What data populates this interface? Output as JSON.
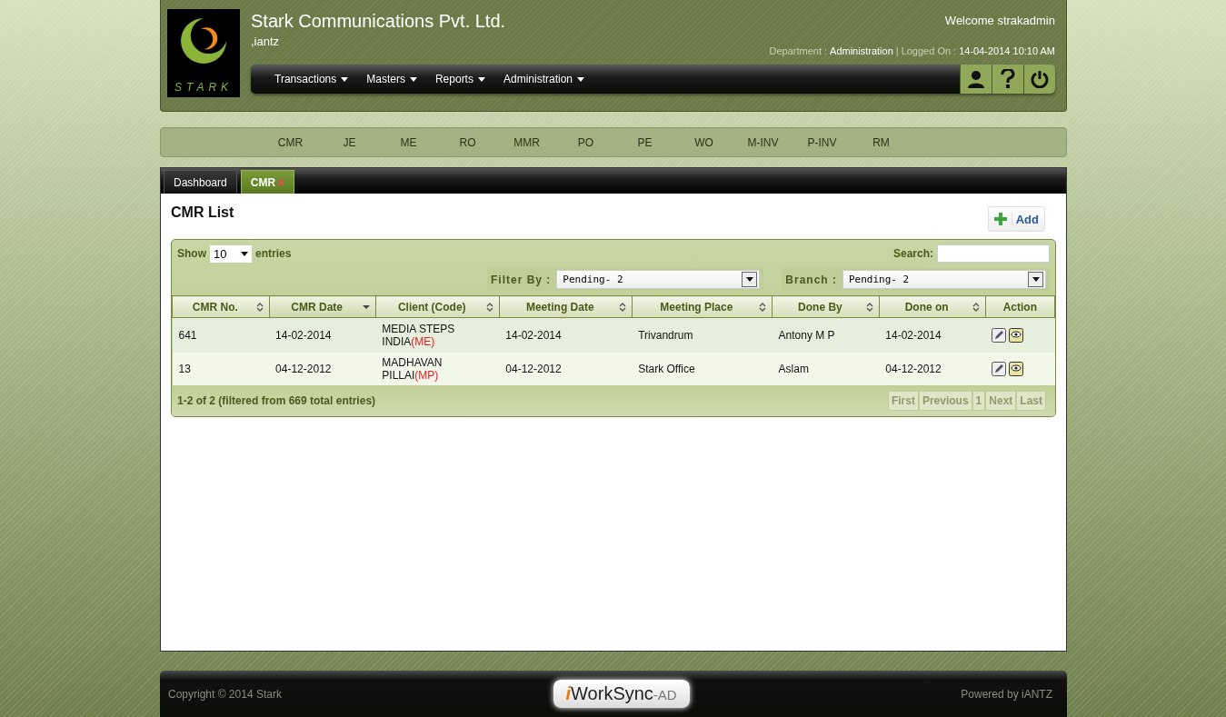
{
  "header": {
    "logo_text": "STARK",
    "company": "Stark Communications Pvt. Ltd.",
    "subtitle": ",iantz",
    "welcome": "Welcome strakadmin",
    "department_label": "Department :",
    "department": "Administration",
    "separator": "|",
    "logged_label": "Logged On :",
    "logged_on": "14-04-2014 10:10 AM",
    "menu": [
      {
        "label": "Transactions"
      },
      {
        "label": "Masters"
      },
      {
        "label": "Reports"
      },
      {
        "label": "Administration"
      }
    ],
    "tools": [
      {
        "kind": "user"
      },
      {
        "kind": "help"
      },
      {
        "kind": "power"
      }
    ]
  },
  "shortcuts": [
    "CMR",
    "JE",
    "ME",
    "RO",
    "MMR",
    "PO",
    "PE",
    "WO",
    "M-INV",
    "P-INV",
    "RM"
  ],
  "tabs": [
    {
      "label": "Dashboard",
      "selected": false,
      "closable": false
    },
    {
      "label": "CMR",
      "selected": true,
      "closable": true
    }
  ],
  "list": {
    "title": "CMR List",
    "add_label": "Add",
    "show_label": "Show",
    "page_size": "10",
    "entries_label": "entries",
    "search_label": "Search:",
    "filter_label": "Filter By :",
    "filter_value": "Pending- 2",
    "branch_label": "Branch :",
    "branch_value": "Pending- 2",
    "columns": [
      {
        "label": "CMR No.",
        "sortable": true,
        "sorted": false
      },
      {
        "label": "CMR Date",
        "sortable": true,
        "sorted": true
      },
      {
        "label": "Client (Code)",
        "sortable": true,
        "sorted": false
      },
      {
        "label": "Meeting Date",
        "sortable": true,
        "sorted": false
      },
      {
        "label": "Meeting Place",
        "sortable": true,
        "sorted": false
      },
      {
        "label": "Done By",
        "sortable": true,
        "sorted": false
      },
      {
        "label": "Done on",
        "sortable": true,
        "sorted": false
      },
      {
        "label": "Action",
        "sortable": false,
        "sorted": false
      }
    ],
    "rows": [
      {
        "no": "641",
        "date": "14-02-2014",
        "client": "MEDIA STEPS INDIA",
        "code": "(ME)",
        "meeting_date": "14-02-2014",
        "place": "Trivandrum",
        "done_by": "Antony M P",
        "done_on": "14-02-2014"
      },
      {
        "no": "13",
        "date": "04-12-2012",
        "client": "MADHAVAN PILLAI",
        "code": "(MP)",
        "meeting_date": "04-12-2012",
        "place": "Stark Office",
        "done_by": "Aslam",
        "done_on": "04-12-2012"
      }
    ],
    "info": "1-2 of 2 (filtered from 669 total entries)",
    "pager": [
      {
        "label": "First",
        "disabled": true
      },
      {
        "label": "Previous",
        "disabled": true
      },
      {
        "label": "1",
        "disabled": true
      },
      {
        "label": "Next",
        "disabled": true
      },
      {
        "label": "Last",
        "disabled": true
      }
    ]
  },
  "footer": {
    "copyright": "Copyright © 2014 Stark",
    "logo_mark": "i",
    "logo_name": "WorkSync",
    "logo_suffix": "-AD",
    "powered": "Powered by iANTZ"
  }
}
